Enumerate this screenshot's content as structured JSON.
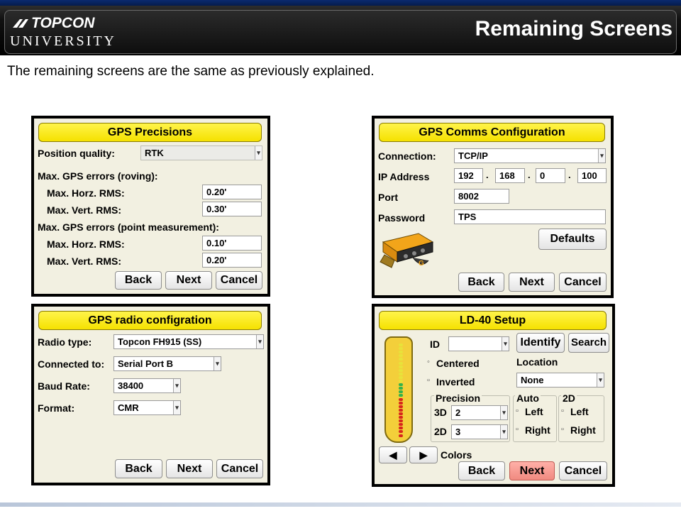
{
  "header": {
    "logo_top": "TOPCON",
    "logo_bottom": "UNIVERSITY",
    "title": "Remaining Screens"
  },
  "subtitle": "The remaining screens are the same as previously explained.",
  "gps_precisions": {
    "title": "GPS Precisions",
    "position_quality_label": "Position quality:",
    "position_quality_value": "RTK",
    "roving_heading": "Max. GPS errors (roving):",
    "roving_horz_label": "Max. Horz. RMS:",
    "roving_horz_value": "0.20'",
    "roving_vert_label": "Max. Vert. RMS:",
    "roving_vert_value": "0.30'",
    "point_heading": "Max. GPS errors (point measurement):",
    "point_horz_label": "Max. Horz. RMS:",
    "point_horz_value": "0.10'",
    "point_vert_label": "Max. Vert. RMS:",
    "point_vert_value": "0.20'",
    "back": "Back",
    "next": "Next",
    "cancel": "Cancel"
  },
  "gps_comms": {
    "title": "GPS Comms Configuration",
    "connection_label": "Connection:",
    "connection_value": "TCP/IP",
    "ip_label": "IP Address",
    "ip": [
      "192",
      "168",
      "0",
      "100"
    ],
    "port_label": "Port",
    "port_value": "8002",
    "password_label": "Password",
    "password_value": "TPS",
    "defaults": "Defaults",
    "back": "Back",
    "next": "Next",
    "cancel": "Cancel"
  },
  "gps_radio": {
    "title": "GPS radio configration",
    "radio_type_label": "Radio type:",
    "radio_type_value": "Topcon FH915 (SS)",
    "connected_label": "Connected to:",
    "connected_value": "Serial Port B",
    "baud_label": "Baud Rate:",
    "baud_value": "38400",
    "format_label": "Format:",
    "format_value": "CMR",
    "back": "Back",
    "next": "Next",
    "cancel": "Cancel"
  },
  "ld40": {
    "title": "LD-40 Setup",
    "id_label": "ID",
    "id_value": "",
    "identify": "Identify",
    "search": "Search",
    "centered": "Centered",
    "inverted": "Inverted",
    "location_label": "Location",
    "location_value": "None",
    "precision_label": "Precision",
    "p3d_label": "3D",
    "p3d_value": "2",
    "p2d_label": "2D",
    "p2d_value": "3",
    "auto_label": "Auto",
    "auto_left": "Left",
    "auto_right": "Right",
    "twod_label": "2D",
    "twod_left": "Left",
    "twod_right": "Right",
    "colors": "Colors",
    "back": "Back",
    "next": "Next",
    "cancel": "Cancel",
    "colors_hex": {
      "next_highlight": "#f08a80",
      "led_yellow": "#e8e23a",
      "led_green": "#34b34a",
      "led_red": "#d8261c"
    }
  },
  "colors": {
    "title_yellow": "#f5e100",
    "panel_bg": "#f2f0e1",
    "header_bg": "#000000"
  }
}
